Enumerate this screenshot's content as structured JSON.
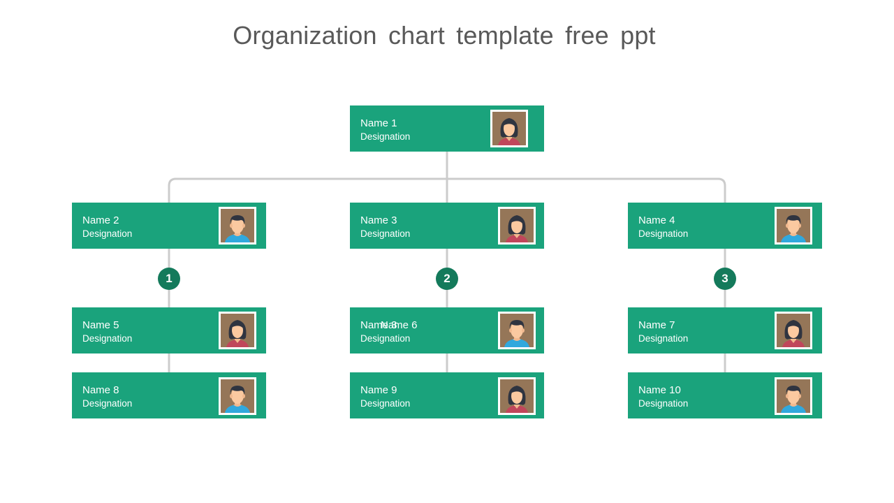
{
  "title": "Organization chart template free ppt",
  "colors": {
    "card": "#1aa37c",
    "badge": "#147a5b",
    "connector": "#cccccc",
    "avatar_bg": "#957658",
    "title_text": "#595959"
  },
  "nodes": [
    {
      "id": 1,
      "name": "Name 1",
      "designation": "Designation",
      "avatar": "female-avatar-icon"
    },
    {
      "id": 2,
      "name": "Name 2",
      "designation": "Designation",
      "avatar": "male-avatar-icon"
    },
    {
      "id": 3,
      "name": "Name 3",
      "designation": "Designation",
      "avatar": "female-avatar-icon"
    },
    {
      "id": 4,
      "name": "Name 4",
      "designation": "Designation",
      "avatar": "male-avatar-icon"
    },
    {
      "id": 5,
      "name": "Name 5",
      "designation": "Designation",
      "avatar": "female-avatar-icon"
    },
    {
      "id": 6,
      "name": "Name 6",
      "ghost_name": "Name 3",
      "designation": "Designation",
      "avatar": "male-avatar-icon"
    },
    {
      "id": 7,
      "name": "Name 7",
      "designation": "Designation",
      "avatar": "female-avatar-icon"
    },
    {
      "id": 8,
      "name": "Name 8",
      "designation": "Designation",
      "avatar": "male-avatar-icon"
    },
    {
      "id": 9,
      "name": "Name 9",
      "designation": "Designation",
      "avatar": "female-avatar-icon"
    },
    {
      "id": 10,
      "name": "Name 10",
      "designation": "Designation",
      "avatar": "male-avatar-icon"
    }
  ],
  "badges": [
    "1",
    "2",
    "3"
  ]
}
